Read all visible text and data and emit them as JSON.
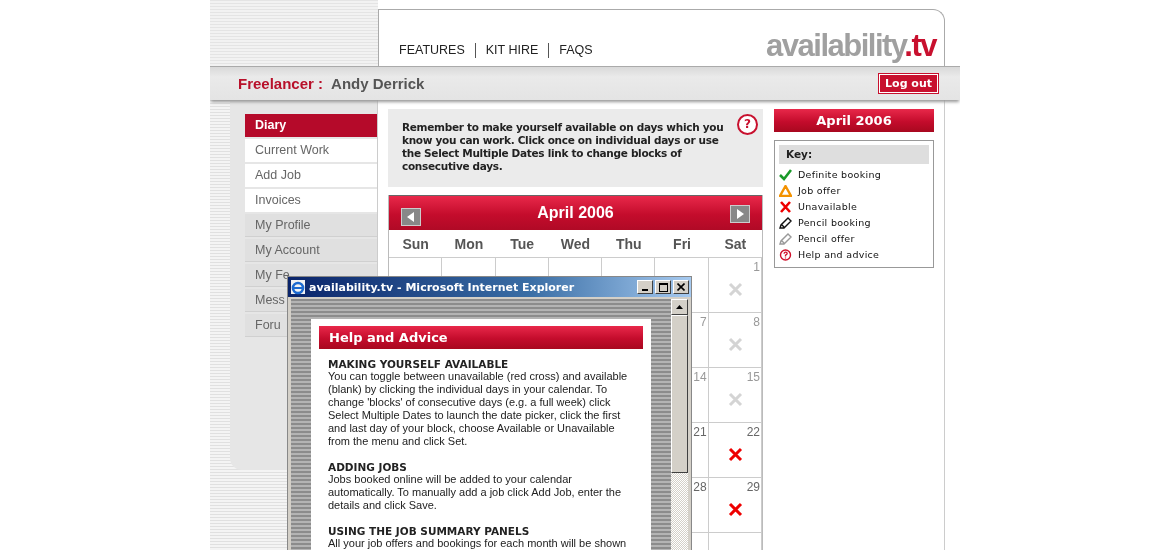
{
  "header": {
    "nav": [
      {
        "label": "FEATURES"
      },
      {
        "label": "KIT HIRE"
      },
      {
        "label": "FAQS"
      }
    ],
    "logo_text": "availability",
    "logo_suffix": ".tv"
  },
  "user_bar": {
    "role": "Freelancer :",
    "name": "Andy Derrick",
    "logout": "Log out"
  },
  "sidebar": {
    "items": [
      {
        "label": "Diary",
        "selected": true,
        "kind": "main"
      },
      {
        "label": "Current Work",
        "selected": false,
        "kind": "main"
      },
      {
        "label": "Add Job",
        "selected": false,
        "kind": "main"
      },
      {
        "label": "Invoices",
        "selected": false,
        "kind": "main"
      },
      {
        "label": "My Profile",
        "selected": false,
        "kind": "account"
      },
      {
        "label": "My Account",
        "selected": false,
        "kind": "account"
      },
      {
        "label": "My Fe",
        "selected": false,
        "kind": "account"
      },
      {
        "label": "Mess",
        "selected": false,
        "kind": "account"
      },
      {
        "label": "Foru",
        "selected": false,
        "kind": "account"
      }
    ]
  },
  "notice": {
    "text": "Remember to make yourself available on days which you know you can work. Click once on individual days or use the Select Multiple Dates link to change blocks of consecutive days.",
    "help": "?"
  },
  "calendar": {
    "title": "April 2006",
    "weekdays": [
      "Sun",
      "Mon",
      "Tue",
      "Wed",
      "Thu",
      "Fri",
      "Sat"
    ],
    "weeks": [
      [
        {
          "day": "1",
          "past": true,
          "unavailable": true
        }
      ],
      [
        {
          "day": "7",
          "past": true
        },
        {
          "day": "8",
          "past": true,
          "unavailable": true
        }
      ],
      [
        {
          "day": "14",
          "past": true
        },
        {
          "day": "15",
          "past": true,
          "unavailable": true
        }
      ],
      [
        {
          "day": "21",
          "past": false
        },
        {
          "day": "22",
          "past": false,
          "unavailable": true
        }
      ],
      [
        {
          "day": "28",
          "past": false
        },
        {
          "day": "29",
          "past": false,
          "unavailable": true
        }
      ]
    ]
  },
  "month_panel": {
    "title": "April 2006",
    "key_title": "Key:",
    "key": [
      {
        "kind": "definite",
        "label": "Definite booking"
      },
      {
        "kind": "offer",
        "label": "Job offer"
      },
      {
        "kind": "unavailable",
        "label": "Unavailable"
      },
      {
        "kind": "pencil",
        "label": "Pencil booking"
      },
      {
        "kind": "pencil_offer",
        "label": "Pencil offer"
      },
      {
        "kind": "help",
        "label": "Help and advice"
      }
    ]
  },
  "popup": {
    "title": "availability.tv - Microsoft Internet Explorer",
    "heading": "Help and Advice",
    "sections": [
      {
        "heading": "MAKING YOURSELF AVAILABLE",
        "text": "You can toggle between unavailable (red cross) and available (blank) by clicking the individual days in your calendar. To change 'blocks' of consecutive days (e.g. a full week) click Select Multiple Dates to launch the date picker, click the first and last day of your block, choose Available or Unavailable from the menu and click Set."
      },
      {
        "heading": "ADDING JOBS",
        "text": "Jobs booked online will be added to your calendar automatically. To manually add a job click Add Job, enter the details and click Save."
      },
      {
        "heading": "USING THE JOB SUMMARY PANELS",
        "text": "All your job offers and bookings for each month will be shown"
      }
    ]
  }
}
